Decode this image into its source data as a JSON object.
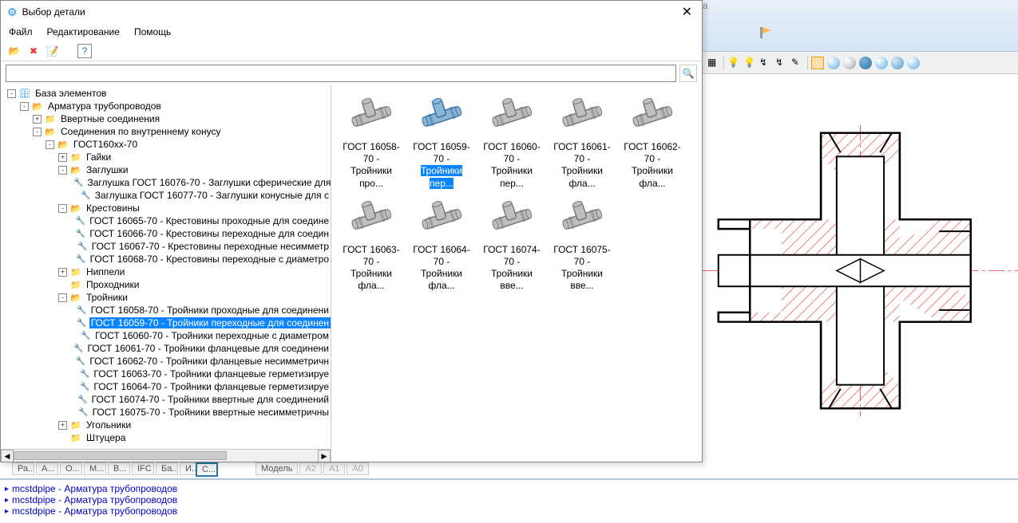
{
  "dialog": {
    "title": "Выбор детали",
    "menu": {
      "file": "Файл",
      "edit": "Редактирование",
      "help": "Помощь"
    }
  },
  "tree": {
    "root": "База элементов",
    "n1": "Арматура трубопроводов",
    "n1_1": "Ввертные соединения",
    "n1_2": "Соединения по внутреннему конусу",
    "n1_2_1": "ГОСТ160xx-70",
    "n1_2_1_1": "Гайки",
    "n1_2_1_2": "Заглушки",
    "n1_2_1_2_1": "Заглушка ГОСТ 16076-70 - Заглушки сферические для",
    "n1_2_1_2_2": "Заглушка ГОСТ 16077-70 - Заглушки конусные для с",
    "n1_2_1_3": "Крестовины",
    "n1_2_1_3_1": "ГОСТ 16065-70 - Крестовины проходные для соедине",
    "n1_2_1_3_2": "ГОСТ 16066-70 - Крестовины переходные для соедин",
    "n1_2_1_3_3": "ГОСТ 16067-70 - Крестовины переходные несимметр",
    "n1_2_1_3_4": "ГОСТ 16068-70 - Крестовины переходные с диаметро",
    "n1_2_1_4": "Ниппели",
    "n1_2_1_5": "Проходники",
    "n1_2_1_6": "Тройники",
    "n1_2_1_6_1": "ГОСТ 16058-70 - Тройники проходные для соединени",
    "n1_2_1_6_2": "ГОСТ 16059-70 - Тройники переходные для соединен",
    "n1_2_1_6_3": "ГОСТ 16060-70 - Тройники переходные с диаметром",
    "n1_2_1_6_4": "ГОСТ 16061-70 - Тройники фланцевые для соединени",
    "n1_2_1_6_5": "ГОСТ 16062-70 - Тройники фланцевые несимметричн",
    "n1_2_1_6_6": "ГОСТ 16063-70 - Тройники фланцевые герметизируе",
    "n1_2_1_6_7": "ГОСТ 16064-70 - Тройники фланцевые герметизируе",
    "n1_2_1_6_8": "ГОСТ 16074-70 - Тройники ввертные для соединений",
    "n1_2_1_6_9": "ГОСТ 16075-70 - Тройники ввертные несимметричны",
    "n1_2_1_7": "Угольники",
    "n1_2_1_8": "Штуцера"
  },
  "thumbs": [
    {
      "l1": "ГОСТ 16058-70 -",
      "l2": "Тройники про...",
      "sel": false
    },
    {
      "l1": "ГОСТ 16059-70 -",
      "l2": "Тройники пер...",
      "sel": true
    },
    {
      "l1": "ГОСТ 16060-70 -",
      "l2": "Тройники пер...",
      "sel": false
    },
    {
      "l1": "ГОСТ 16061-70 -",
      "l2": "Тройники фла...",
      "sel": false
    },
    {
      "l1": "ГОСТ 16062-70 -",
      "l2": "Тройники фла...",
      "sel": false
    },
    {
      "l1": "ГОСТ 16063-70 -",
      "l2": "Тройники фла...",
      "sel": false
    },
    {
      "l1": "ГОСТ 16064-70 -",
      "l2": "Тройники фла...",
      "sel": false
    },
    {
      "l1": "ГОСТ 16074-70 -",
      "l2": "Тройники вве...",
      "sel": false
    },
    {
      "l1": "ГОСТ 16075-70 -",
      "l2": "Тройники вве...",
      "sel": false
    }
  ],
  "bg": {
    "a": "а"
  },
  "tabs": [
    "Ра...",
    "А...",
    "О...",
    "М...",
    "В...",
    "IFC",
    "Ба...",
    "И..."
  ],
  "tabs2": [
    "С..."
  ],
  "midtabs": [
    "Модель",
    "A2",
    "A1",
    "A0"
  ],
  "console": [
    "mcstdpipe - Арматура трубопроводов",
    "mcstdpipe - Арматура трубопроводов",
    "mcstdpipe - Арматура трубопроводов"
  ]
}
